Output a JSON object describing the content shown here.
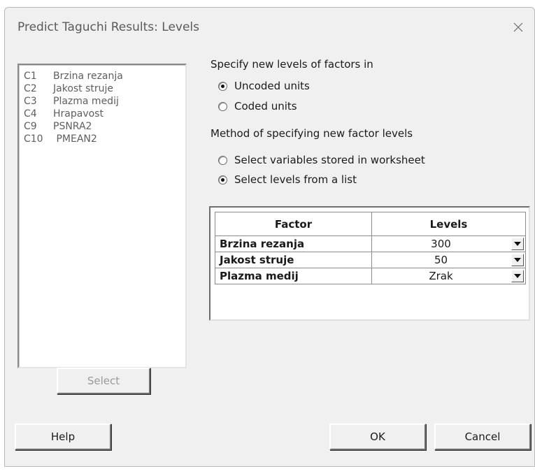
{
  "window": {
    "title": "Predict Taguchi Results: Levels"
  },
  "variables": [
    {
      "col": "C1",
      "name": "Brzina rezanja"
    },
    {
      "col": "C2",
      "name": "Jakost struje"
    },
    {
      "col": "C3",
      "name": "Plazma medij"
    },
    {
      "col": "C4",
      "name": "Hrapavost"
    },
    {
      "col": "C9",
      "name": "PSNRA2"
    },
    {
      "col": "C10",
      "name": " PMEAN2"
    }
  ],
  "select_button": "Select",
  "units": {
    "label": "Specify new levels of factors in",
    "options": [
      {
        "label": "Uncoded units",
        "checked": true
      },
      {
        "label": "Coded units",
        "checked": false
      }
    ]
  },
  "method": {
    "label": "Method of specifying new factor levels",
    "options": [
      {
        "label": "Select variables stored in worksheet",
        "checked": false
      },
      {
        "label": "Select levels from a list",
        "checked": true
      }
    ]
  },
  "table": {
    "headers": [
      "Factor",
      "Levels"
    ],
    "rows": [
      {
        "factor": "Brzina rezanja",
        "level": "300"
      },
      {
        "factor": "Jakost struje",
        "level": "50"
      },
      {
        "factor": "Plazma medij",
        "level": "Zrak"
      }
    ]
  },
  "buttons": {
    "help": "Help",
    "ok": "OK",
    "cancel": "Cancel"
  },
  "icons": {
    "close": "close-icon",
    "dropdown": "chevron-down-icon"
  }
}
